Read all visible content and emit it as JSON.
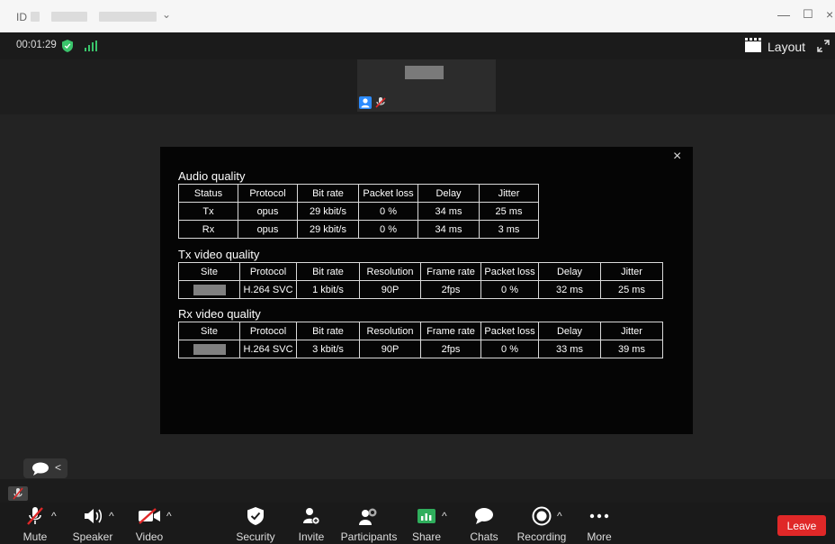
{
  "titlebar": {
    "id_label": "ID",
    "minimize": "—",
    "maximize": "☐",
    "close": "×"
  },
  "status": {
    "timer": "00:01:29",
    "layout_label": "Layout"
  },
  "dialog": {
    "close": "×",
    "audio": {
      "title": "Audio quality",
      "headers": [
        "Status",
        "Protocol",
        "Bit rate",
        "Packet loss",
        "Delay",
        "Jitter"
      ],
      "rows": [
        [
          "Tx",
          "opus",
          "29 kbit/s",
          "0 %",
          "34 ms",
          "25 ms"
        ],
        [
          "Rx",
          "opus",
          "29 kbit/s",
          "0 %",
          "34 ms",
          "3 ms"
        ]
      ]
    },
    "tx_video": {
      "title": "Tx video quality",
      "headers": [
        "Site",
        "Protocol",
        "Bit rate",
        "Resolution",
        "Frame rate",
        "Packet loss",
        "Delay",
        "Jitter"
      ],
      "row": [
        "",
        "H.264 SVC",
        "1 kbit/s",
        "90P",
        "2fps",
        "0 %",
        "32 ms",
        "25 ms"
      ]
    },
    "rx_video": {
      "title": "Rx video quality",
      "headers": [
        "Site",
        "Protocol",
        "Bit rate",
        "Resolution",
        "Frame rate",
        "Packet loss",
        "Delay",
        "Jitter"
      ],
      "row": [
        "",
        "H.264 SVC",
        "3 kbit/s",
        "90P",
        "2fps",
        "0 %",
        "33 ms",
        "39 ms"
      ]
    }
  },
  "toolbar": {
    "mute": "Mute",
    "speaker": "Speaker",
    "video": "Video",
    "security": "Security",
    "invite": "Invite",
    "participants": "Participants",
    "share": "Share",
    "chats": "Chats",
    "recording": "Recording",
    "more": "More",
    "leave": "Leave"
  },
  "colors": {
    "accent_blue": "#2d8cff",
    "leave_red": "#e02828",
    "shield_green": "#3ac46b",
    "share_green": "#2fae5c"
  }
}
